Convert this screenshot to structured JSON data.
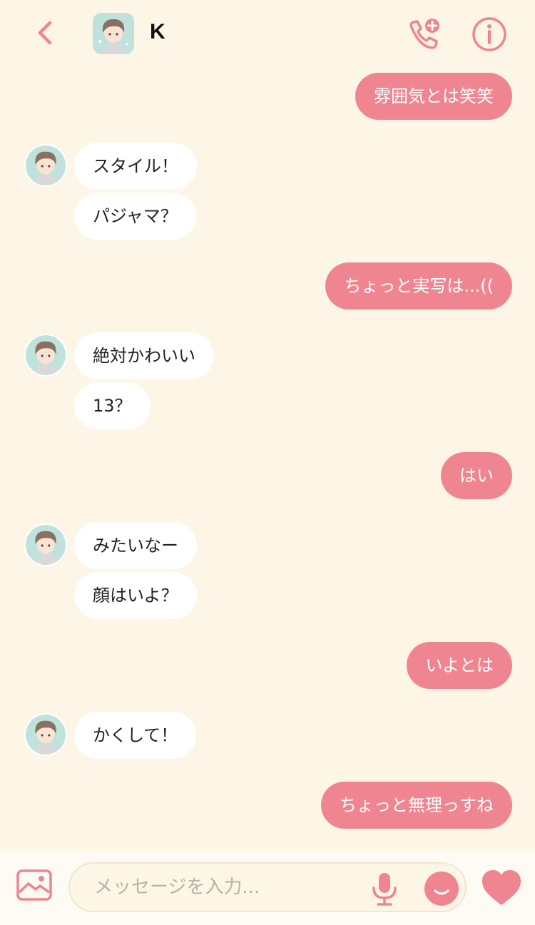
{
  "colors": {
    "accent": "#ef8590",
    "background": "#fdf6e6",
    "incoming_bubble": "#ffffff",
    "outgoing_text": "#ffffff"
  },
  "header": {
    "contact_name": "K",
    "back_icon": "chevron-left-icon",
    "call_icon": "phone-plus-icon",
    "info_icon": "info-icon"
  },
  "messages": [
    {
      "dir": "out",
      "text": "雰囲気とは笑笑"
    },
    {
      "dir": "in",
      "text": "スタイル！"
    },
    {
      "dir": "in",
      "text": "パジャマ？"
    },
    {
      "dir": "out",
      "text": "ちょっと実写は...(("
    },
    {
      "dir": "in",
      "text": "絶対かわいい"
    },
    {
      "dir": "in",
      "text": "13？"
    },
    {
      "dir": "out",
      "text": "はい"
    },
    {
      "dir": "in",
      "text": "みたいなー"
    },
    {
      "dir": "in",
      "text": "顔はいよ？"
    },
    {
      "dir": "out",
      "text": "いよとは"
    },
    {
      "dir": "in",
      "text": "かくして！"
    },
    {
      "dir": "out",
      "text": "ちょっと無理っすね"
    }
  ],
  "input": {
    "placeholder": "メッセージを入力...",
    "image_icon": "image-icon",
    "mic_icon": "microphone-icon",
    "emoji_icon": "smiley-icon",
    "send_icon": "heart-icon"
  }
}
